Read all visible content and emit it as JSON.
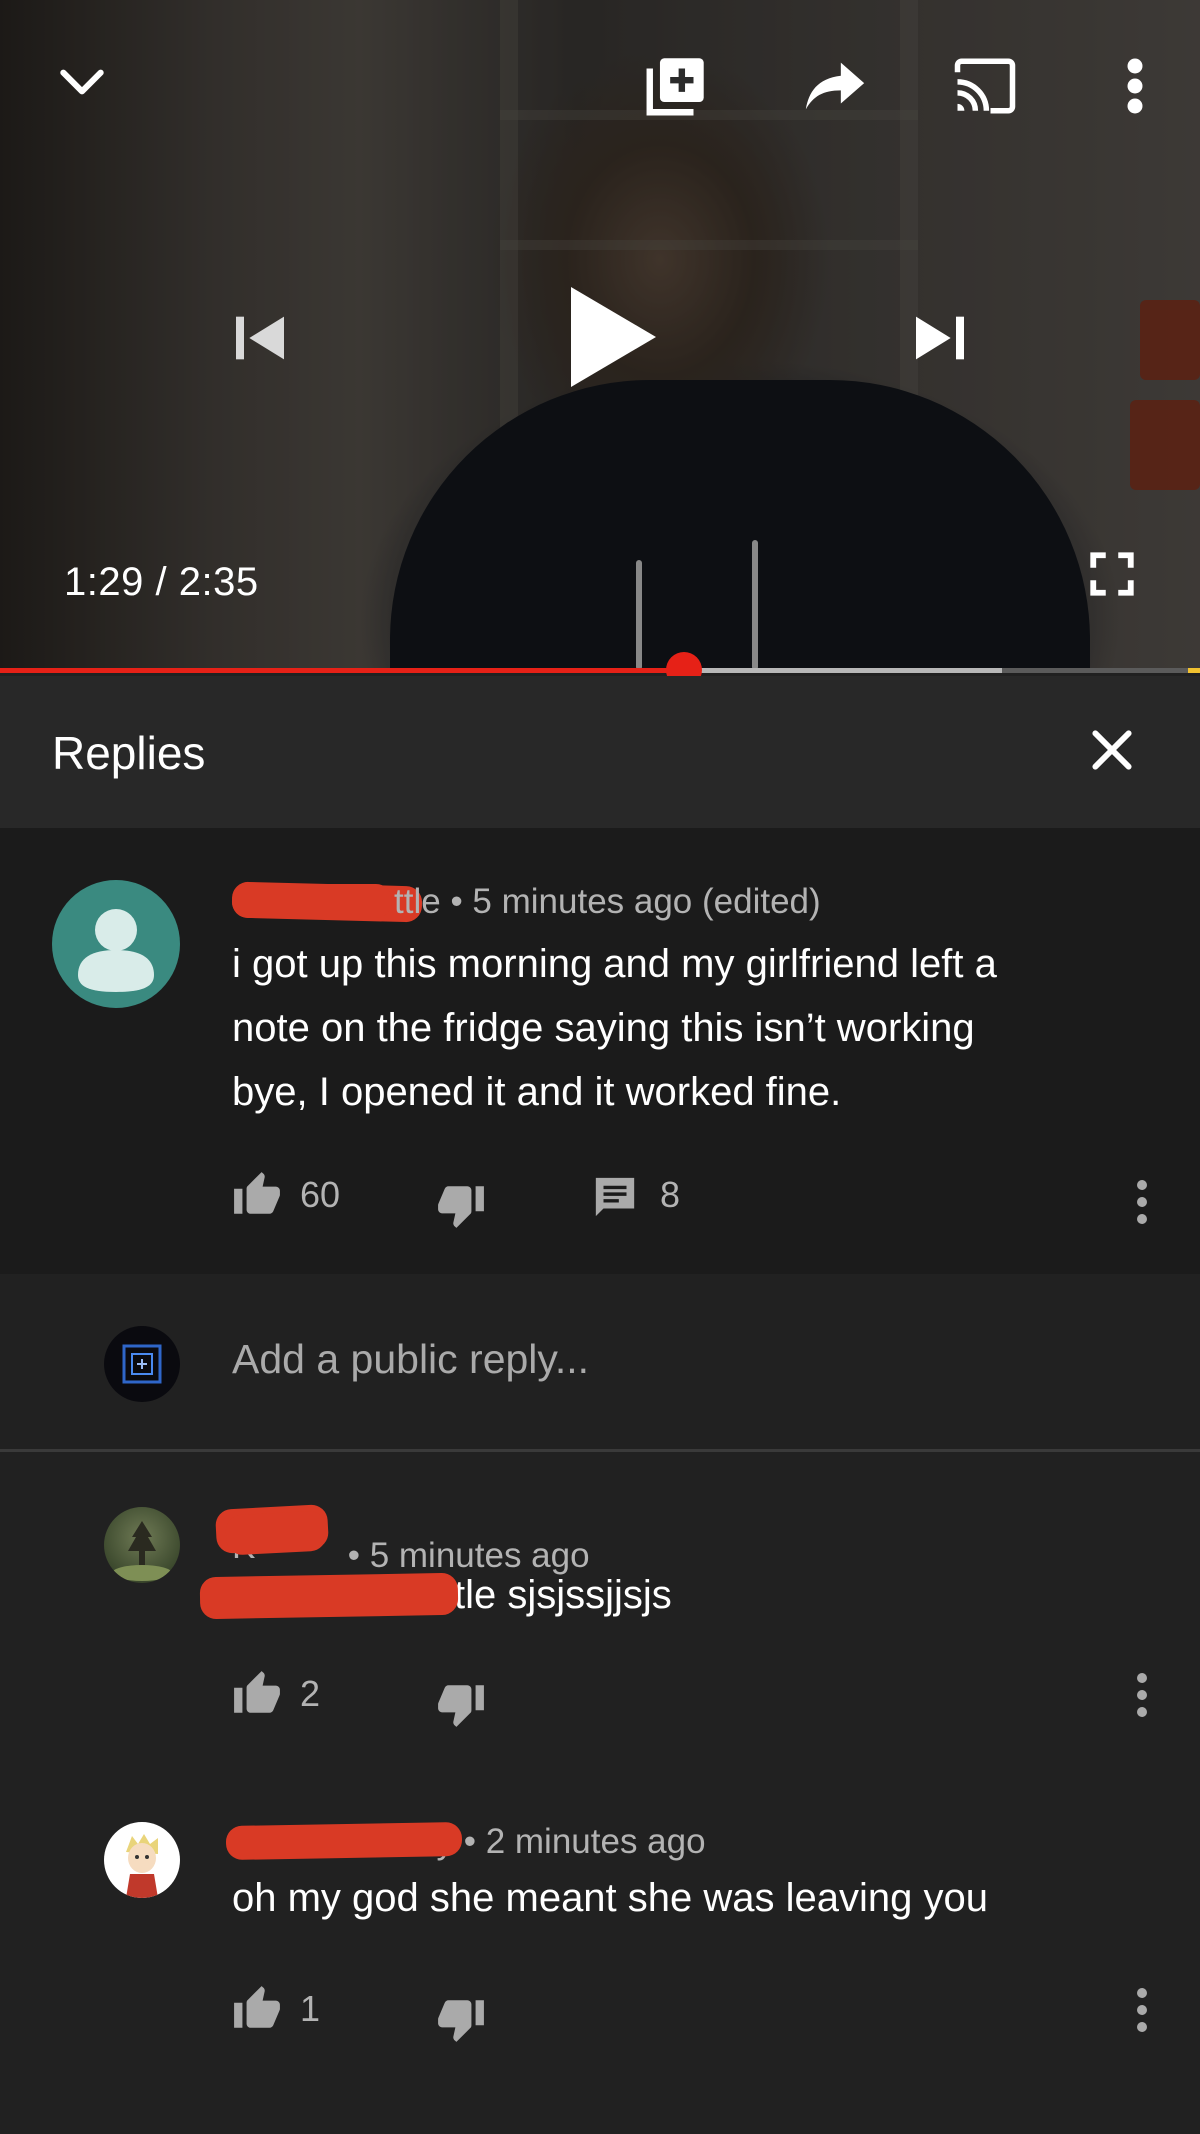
{
  "player": {
    "current_time": "1:29",
    "separator": "/",
    "duration": "2:35",
    "progress_fraction": 0.57,
    "buffer_fraction": 0.835,
    "colors": {
      "played": "#e62117",
      "buffer": "#b8b8b8",
      "track": "#5b5b5b"
    },
    "icons": [
      "chevron-down-icon",
      "add-to-playlist-icon",
      "share-icon",
      "cast-icon",
      "more-vert-icon",
      "previous-icon",
      "play-icon",
      "next-icon",
      "fullscreen-icon"
    ]
  },
  "replies_panel": {
    "title": "Replies",
    "close_icon": "close-icon"
  },
  "main_comment": {
    "author_visible_fragment": "ttle",
    "timestamp": "• 5 minutes ago (edited)",
    "text_lines": [
      "i got up this morning and my girlfriend left a",
      "note on the fridge saying this isn’t working",
      "bye, I opened it and it worked fine."
    ],
    "likes": "60",
    "replies": "8",
    "avatar_color": "#3a8a80"
  },
  "add_reply": {
    "placeholder": "Add a public reply..."
  },
  "replies": [
    {
      "author_visible_fragment": "K",
      "timestamp": "• 5 minutes ago",
      "text_visible_fragment": "tle sjsjssjjsjs",
      "likes": "2"
    },
    {
      "author_visible_fragment": "nny",
      "timestamp": "• 2 minutes ago",
      "text": "oh my god she meant she was leaving you",
      "likes": "1"
    }
  ],
  "colors": {
    "redaction": "#d93a25",
    "background": "#212121",
    "panel_header": "#282828",
    "main_comment_bg": "#1b1b1b"
  }
}
